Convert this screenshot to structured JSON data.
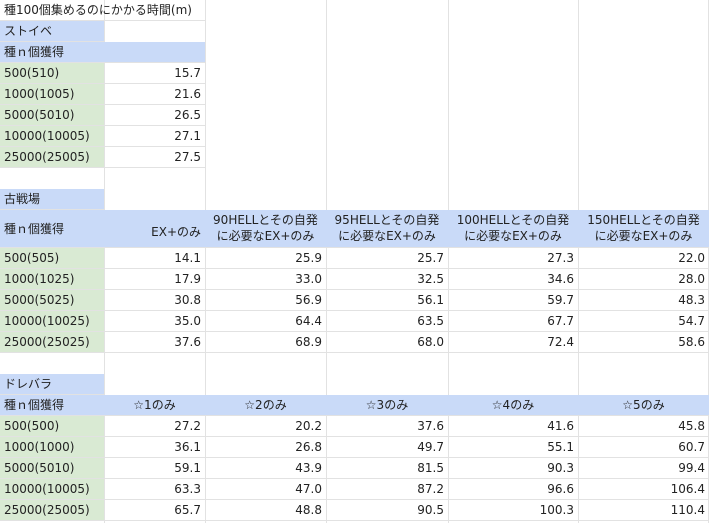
{
  "title": "種100個集めるのにかかる時間(m)",
  "sections": [
    {
      "name": "ストイベ",
      "header": [
        "種ｎ個獲得"
      ],
      "rows": [
        [
          "500(510)",
          "15.7"
        ],
        [
          "1000(1005)",
          "21.6"
        ],
        [
          "5000(5010)",
          "26.5"
        ],
        [
          "10000(10005)",
          "27.1"
        ],
        [
          "25000(25005)",
          "27.5"
        ]
      ]
    },
    {
      "name": "古戦場",
      "header": [
        "種ｎ個獲得",
        "EX+のみ",
        "90HELLとその自発\nに必要なEX+のみ",
        "95HELLとその自発\nに必要なEX+のみ",
        "100HELLとその自発\nに必要なEX+のみ",
        "150HELLとその自発\nに必要なEX+のみ"
      ],
      "rows": [
        [
          "500(505)",
          "14.1",
          "25.9",
          "25.7",
          "27.3",
          "22.0"
        ],
        [
          "1000(1025)",
          "17.9",
          "33.0",
          "32.5",
          "34.6",
          "28.0"
        ],
        [
          "5000(5025)",
          "30.8",
          "56.9",
          "56.1",
          "59.7",
          "48.3"
        ],
        [
          "10000(10025)",
          "35.0",
          "64.4",
          "63.5",
          "67.7",
          "54.7"
        ],
        [
          "25000(25025)",
          "37.6",
          "68.9",
          "68.0",
          "72.4",
          "58.6"
        ]
      ]
    },
    {
      "name": "ドレバラ",
      "header": [
        "種ｎ個獲得",
        "☆1のみ",
        "☆2のみ",
        "☆3のみ",
        "☆4のみ",
        "☆5のみ"
      ],
      "rows": [
        [
          "500(500)",
          "27.2",
          "20.2",
          "37.6",
          "41.6",
          "45.8"
        ],
        [
          "1000(1000)",
          "36.1",
          "26.8",
          "49.7",
          "55.1",
          "60.7"
        ],
        [
          "5000(5010)",
          "59.1",
          "43.9",
          "81.5",
          "90.3",
          "99.4"
        ],
        [
          "10000(10005)",
          "63.3",
          "47.0",
          "87.2",
          "96.6",
          "106.4"
        ],
        [
          "25000(25005)",
          "65.7",
          "48.8",
          "90.5",
          "100.3",
          "110.4"
        ]
      ]
    }
  ],
  "colors": {
    "header_blue": "#c9daf8",
    "label_green": "#d9ead3",
    "grid": "#e2e2e2"
  }
}
